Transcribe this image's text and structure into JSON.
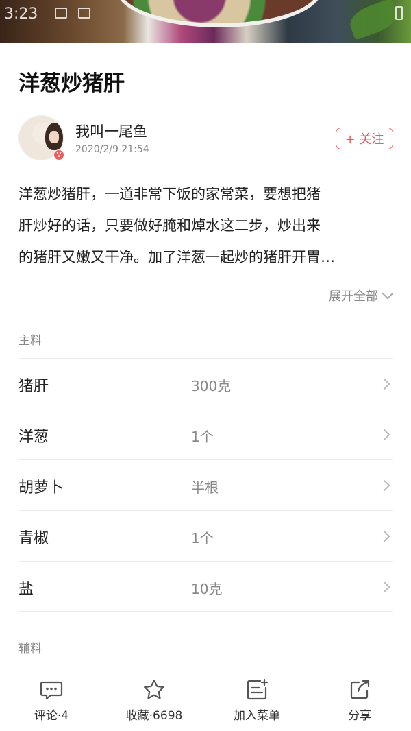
{
  "status_bar": {
    "time": "3:23"
  },
  "recipe": {
    "title": "洋葱炒猪肝",
    "author": {
      "name": "我叫一尾鱼",
      "date": "2020/2/9 21:54",
      "badge": "V"
    },
    "follow_label": "+ 关注",
    "description_lines": [
      "洋葱炒猪肝，一道非常下饭的家常菜，要想把猪",
      "肝炒好的话，只要做好腌和焯水这二步，炒出来",
      "的猪肝又嫩又干净。加了洋葱一起炒的猪肝开胃…"
    ],
    "expand_label": "展开全部"
  },
  "ingredients": {
    "main_label": "主料",
    "items": [
      {
        "name": "猪肝",
        "amount": "300克"
      },
      {
        "name": "洋葱",
        "amount": "1个"
      },
      {
        "name": "胡萝卜",
        "amount": "半根"
      },
      {
        "name": "青椒",
        "amount": "1个"
      },
      {
        "name": "盐",
        "amount": "10克"
      }
    ],
    "aux_label": "辅料"
  },
  "bottom_bar": {
    "comment": "评论·4",
    "favorite": "收藏·6698",
    "add_menu": "加入菜单",
    "share": "分享"
  },
  "colors": {
    "accent": "#f05a5a",
    "secondary_text": "#888888",
    "divider": "#ececec"
  }
}
